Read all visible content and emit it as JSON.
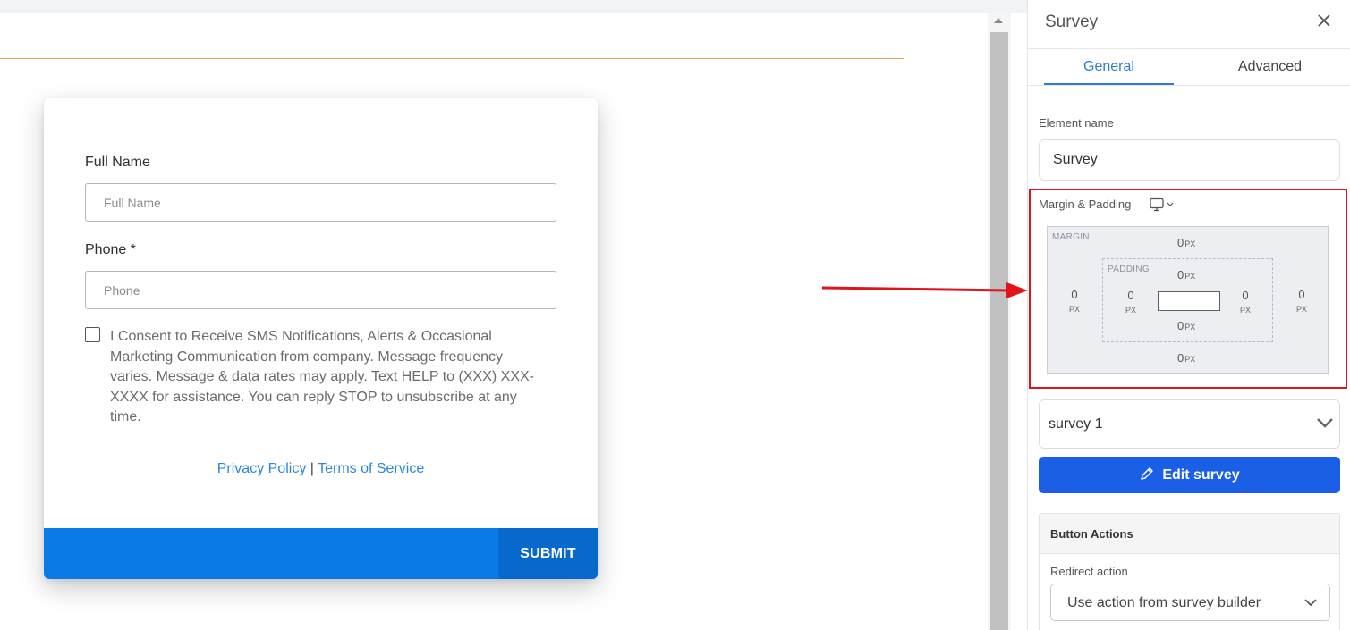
{
  "form": {
    "full_name_label": "Full Name",
    "full_name_placeholder": "Full Name",
    "phone_label": "Phone *",
    "phone_placeholder": "Phone",
    "consent_text": "I Consent to Receive SMS Notifications, Alerts & Occasional Marketing Communication from company. Message frequency varies. Message & data rates may apply. Text HELP to (XXX) XXX-XXXX for assistance. You can reply STOP to unsubscribe at any time.",
    "privacy_link": "Privacy Policy",
    "link_separator": " | ",
    "terms_link": "Terms of Service",
    "submit_label": "SUBMIT"
  },
  "panel": {
    "title": "Survey",
    "tabs": [
      {
        "label": "General",
        "active": true
      },
      {
        "label": "Advanced",
        "active": false
      }
    ],
    "element_name_label": "Element name",
    "element_name_value": "Survey",
    "margin_padding_label": "Margin & Padding",
    "margin_tag": "MARGIN",
    "padding_tag": "PADDING",
    "unit": "PX",
    "margin": {
      "top": "0",
      "right": "0",
      "bottom": "0",
      "left": "0"
    },
    "padding": {
      "top": "0",
      "right": "0",
      "bottom": "0",
      "left": "0"
    },
    "survey_select_value": "survey 1",
    "edit_survey_label": "Edit survey",
    "button_actions_title": "Button Actions",
    "redirect_label": "Redirect action",
    "redirect_select_value": "Use action from survey builder"
  },
  "colors": {
    "primary": "#0a7ae6",
    "edit_button": "#1a5fe6",
    "link": "#2b88d8",
    "tab_active": "#2b7dd4",
    "highlight": "#e0141b",
    "section_outline": "#e8a04c"
  },
  "icons": [
    "close-icon",
    "monitor-icon",
    "chevron-down-icon",
    "pencil-icon",
    "arrow-right-icon"
  ]
}
